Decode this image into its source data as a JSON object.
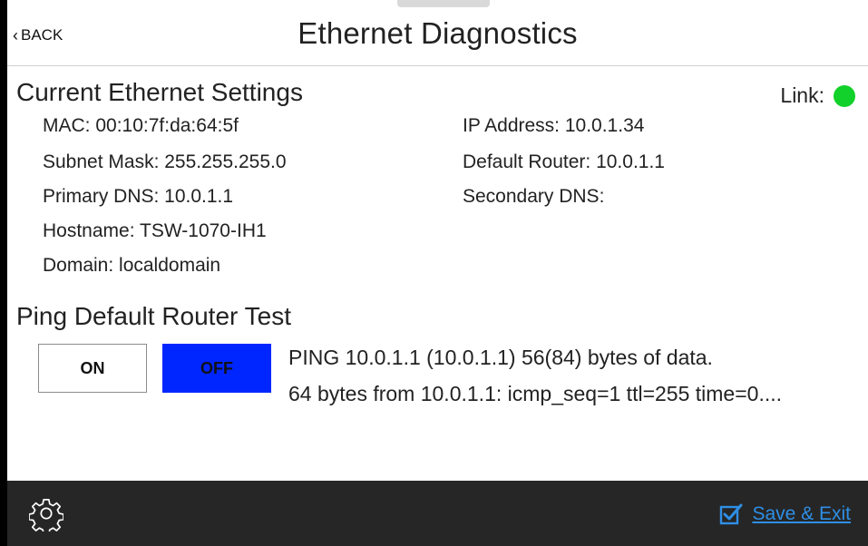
{
  "header": {
    "back_label": "BACK",
    "title": "Ethernet Diagnostics"
  },
  "current_settings": {
    "section_title": "Current Ethernet Settings",
    "link_label": "Link:",
    "link_status_color": "#12d12a",
    "mac": "MAC: 00:10:7f:da:64:5f",
    "subnet_mask": "Subnet Mask: 255.255.255.0",
    "primary_dns": "Primary DNS: 10.0.1.1",
    "hostname": "Hostname: TSW-1070-IH1",
    "domain": "Domain: localdomain",
    "ip_address": "IP Address: 10.0.1.34",
    "default_router": "Default Router: 10.0.1.1",
    "secondary_dns": "Secondary DNS:"
  },
  "ping_test": {
    "section_title": "Ping Default Router Test",
    "on_label": "ON",
    "off_label": "OFF",
    "active_color": "#0026ff",
    "selected": "OFF",
    "output_line_1": "PING 10.0.1.1 (10.0.1.1) 56(84) bytes of data.",
    "output_line_2": "64 bytes from 10.0.1.1: icmp_seq=1 ttl=255 time=0...."
  },
  "footer": {
    "settings_icon": "gear-icon",
    "save_icon": "checkbox-checked-icon",
    "save_label": "Save & Exit",
    "save_color": "#2e8fe6"
  }
}
